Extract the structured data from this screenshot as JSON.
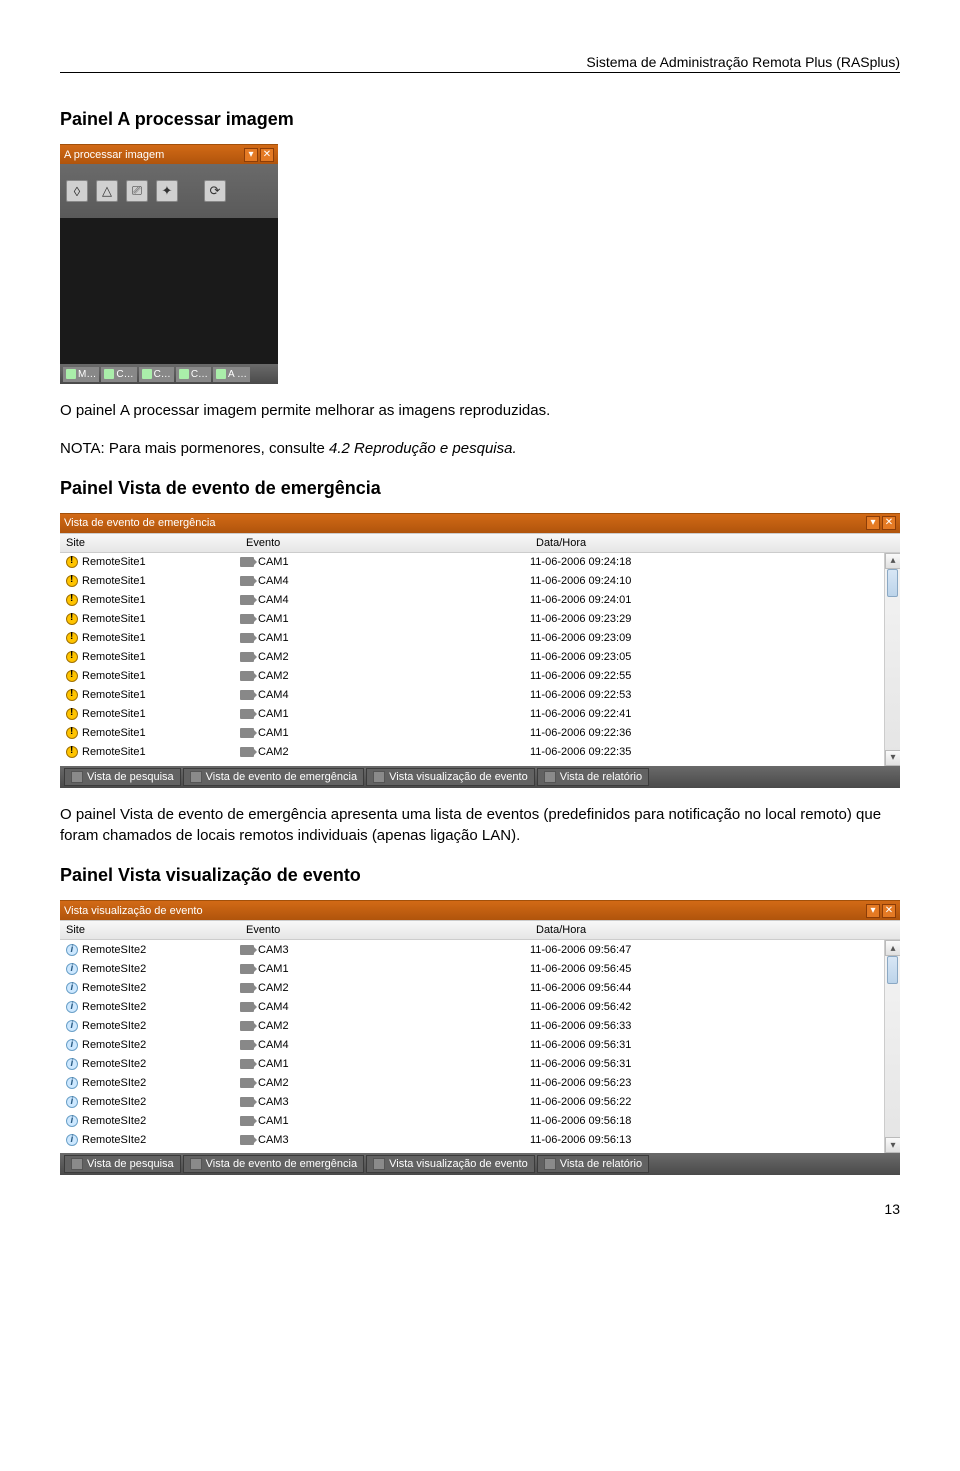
{
  "header": {
    "doc_title": "Sistema de Administração Remota Plus (RASplus)"
  },
  "sections": {
    "s1_title": "Painel A processar imagem",
    "s1_body_part1": "O painel ",
    "s1_body_em": "A processar imagem",
    "s1_body_part2": " permite melhorar as imagens reproduzidas.",
    "s1_note_part1": "NOTA: Para mais pormenores, consulte ",
    "s1_note_em": "4.2 Reprodução e pesquisa.",
    "s2_title": "Painel Vista de evento de emergência",
    "s2_body_part1": "O painel ",
    "s2_body_em": "Vista de evento de emergência",
    "s2_body_part2": " apresenta uma lista de eventos (predefinidos para notificação no local remoto) que foram chamados de locais remotos individuais (apenas ligação LAN).",
    "s3_title": "Painel Vista visualização de evento"
  },
  "small_panel": {
    "title": "A processar imagem",
    "strip": [
      "M…",
      "C…",
      "C…",
      "C…",
      "A …"
    ],
    "tool_icons": [
      "drop-icon",
      "triangle-icon",
      "sliders-icon",
      "sparkle-icon",
      "refresh-icon"
    ]
  },
  "grid1": {
    "title": "Vista de evento de emergência",
    "headers": {
      "site": "Site",
      "evento": "Evento",
      "data": "Data/Hora"
    },
    "rows": [
      {
        "site": "RemoteSite1",
        "ev": "CAM1",
        "dt": "11-06-2006  09:24:18"
      },
      {
        "site": "RemoteSite1",
        "ev": "CAM4",
        "dt": "11-06-2006  09:24:10"
      },
      {
        "site": "RemoteSite1",
        "ev": "CAM4",
        "dt": "11-06-2006  09:24:01"
      },
      {
        "site": "RemoteSite1",
        "ev": "CAM1",
        "dt": "11-06-2006  09:23:29"
      },
      {
        "site": "RemoteSite1",
        "ev": "CAM1",
        "dt": "11-06-2006  09:23:09"
      },
      {
        "site": "RemoteSite1",
        "ev": "CAM2",
        "dt": "11-06-2006  09:23:05"
      },
      {
        "site": "RemoteSite1",
        "ev": "CAM2",
        "dt": "11-06-2006  09:22:55"
      },
      {
        "site": "RemoteSite1",
        "ev": "CAM4",
        "dt": "11-06-2006  09:22:53"
      },
      {
        "site": "RemoteSite1",
        "ev": "CAM1",
        "dt": "11-06-2006  09:22:41"
      },
      {
        "site": "RemoteSite1",
        "ev": "CAM1",
        "dt": "11-06-2006  09:22:36"
      },
      {
        "site": "RemoteSite1",
        "ev": "CAM2",
        "dt": "11-06-2006  09:22:35"
      }
    ]
  },
  "grid2": {
    "title": "Vista visualização de evento",
    "headers": {
      "site": "Site",
      "evento": "Evento",
      "data": "Data/Hora"
    },
    "rows": [
      {
        "site": "RemoteSIte2",
        "ev": "CAM3",
        "dt": "11-06-2006  09:56:47"
      },
      {
        "site": "RemoteSIte2",
        "ev": "CAM1",
        "dt": "11-06-2006  09:56:45"
      },
      {
        "site": "RemoteSIte2",
        "ev": "CAM2",
        "dt": "11-06-2006  09:56:44"
      },
      {
        "site": "RemoteSIte2",
        "ev": "CAM4",
        "dt": "11-06-2006  09:56:42"
      },
      {
        "site": "RemoteSIte2",
        "ev": "CAM2",
        "dt": "11-06-2006  09:56:33"
      },
      {
        "site": "RemoteSIte2",
        "ev": "CAM4",
        "dt": "11-06-2006  09:56:31"
      },
      {
        "site": "RemoteSIte2",
        "ev": "CAM1",
        "dt": "11-06-2006  09:56:31"
      },
      {
        "site": "RemoteSIte2",
        "ev": "CAM2",
        "dt": "11-06-2006  09:56:23"
      },
      {
        "site": "RemoteSIte2",
        "ev": "CAM3",
        "dt": "11-06-2006  09:56:22"
      },
      {
        "site": "RemoteSIte2",
        "ev": "CAM1",
        "dt": "11-06-2006  09:56:18"
      },
      {
        "site": "RemoteSIte2",
        "ev": "CAM3",
        "dt": "11-06-2006  09:56:13"
      }
    ]
  },
  "footer_tabs": {
    "t1": "Vista de pesquisa",
    "t2": "Vista de evento de emergência",
    "t3": "Vista visualização de evento",
    "t4": "Vista de relatório"
  },
  "page_number": "13"
}
